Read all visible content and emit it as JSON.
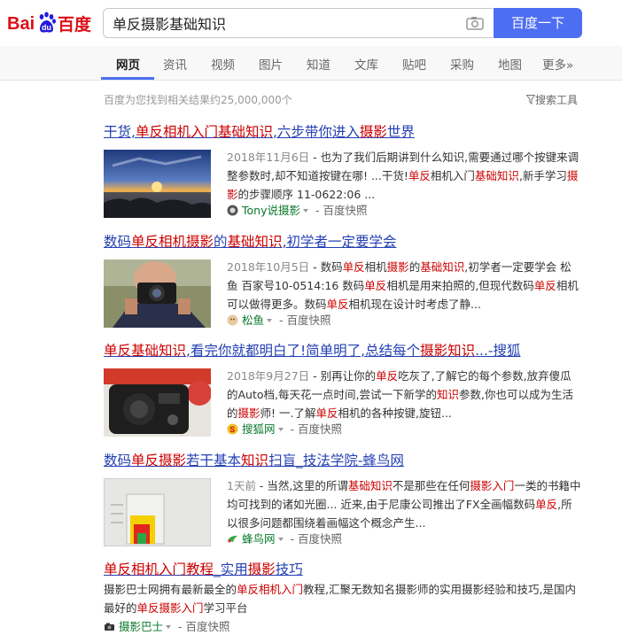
{
  "header": {
    "logo_text_left": "Bai",
    "logo_text_du": "du",
    "logo_text_right": "百度",
    "query": "单反摄影基础知识",
    "search_button": "百度一下"
  },
  "tabs": [
    {
      "label": "网页",
      "active": true
    },
    {
      "label": "资讯"
    },
    {
      "label": "视频"
    },
    {
      "label": "图片"
    },
    {
      "label": "知道"
    },
    {
      "label": "文库"
    },
    {
      "label": "贴吧"
    },
    {
      "label": "采购"
    },
    {
      "label": "地图"
    },
    {
      "label": "更多»"
    }
  ],
  "meta": {
    "result_count": "百度为您找到相关结果约25,000,000个",
    "search_tools": "搜索工具"
  },
  "results": [
    {
      "title_parts": [
        "干货,",
        "单反相机入门基础知识",
        ",六步带你进入",
        "摄影",
        "世界"
      ],
      "date": "2018年11月6日",
      "snippet_parts": [
        " - 也为了我们后期讲到什么知识,需要通过哪个按键来调整参数时,却不知道按键在哪! ...干货!",
        "单反",
        "相机入门",
        "基础知识",
        ",新手学习",
        "摄影",
        "的步骤顺序 11-0622:06 ..."
      ],
      "source": "Tony说摄影",
      "snapshot": "百度快照"
    },
    {
      "title_parts": [
        "数码",
        "单反相机摄影",
        "的",
        "基础知识",
        ",初学者一定要学会"
      ],
      "date": "2018年10月5日",
      "snippet_parts": [
        " - 数码",
        "单反",
        "相机",
        "摄影",
        "的",
        "基础知识",
        ",初学者一定要学会 松鱼 百家号10-0514:16 数码",
        "单反",
        "相机是用来拍照的,但现代数码",
        "单反",
        "相机可以做得更多。数码",
        "单反",
        "相机现在设计时考虑了静..."
      ],
      "source": "松鱼",
      "snapshot": "百度快照"
    },
    {
      "title_parts": [
        "",
        "单反基础知识",
        ",看完你就都明白了!简单明了,总结每个",
        "摄影知识",
        "...-搜狐"
      ],
      "date": "2018年9月27日",
      "snippet_parts": [
        " - 别再让你的",
        "单反",
        "吃灰了,了解它的每个参数,放弃傻瓜的Auto档,每天花一点时间,尝试一下新学的",
        "知识",
        "参数,你也可以成为生活的",
        "摄影",
        "师! 一.了解",
        "单反",
        "相机的各种按键,旋钮..."
      ],
      "source": "搜狐网",
      "snapshot": "百度快照"
    },
    {
      "title_parts": [
        "数码",
        "单反摄影",
        "若干基本",
        "知识",
        "扫盲_技法学院-蜂鸟网"
      ],
      "date": "1天前",
      "snippet_parts": [
        " - 当然,这里的所谓",
        "基础知识",
        "不是那些在任何",
        "摄影入门",
        "一类的书籍中均可找到的诸如光圈... 近来,由于尼康公司推出了FX全画幅数码",
        "单反",
        ",所以很多问题都围绕着画幅这个概念产生..."
      ],
      "source": "蜂鸟网",
      "snapshot": "百度快照"
    },
    {
      "title_parts": [
        "",
        "单反相机入门教程",
        "_实用",
        "摄影",
        "技巧"
      ],
      "snippet_parts": [
        "摄影巴士网拥有最新最全的",
        "单反相机入门",
        "教程,汇聚无数知名摄影师的实用摄影经验和技巧,是国内最好的",
        "单反摄影入门",
        "学习平台"
      ],
      "source": "摄影巴士",
      "snapshot": "百度快照"
    }
  ]
}
